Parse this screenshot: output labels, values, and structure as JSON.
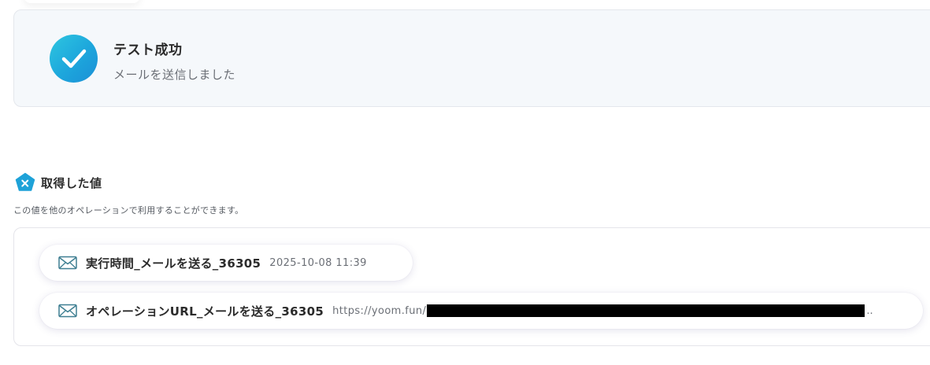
{
  "success": {
    "title": "テスト成功",
    "message": "メールを送信しました",
    "icon": "check-icon",
    "accent": "#1da6dc"
  },
  "values_section": {
    "icon": "pentagon-x-icon",
    "title": "取得した値",
    "description": "この値を他のオペレーションで利用することができます。",
    "items": [
      {
        "icon": "mail-icon",
        "label": "実行時間_メールを送る_36305",
        "value": "2025-10-08 11:39"
      },
      {
        "icon": "mail-icon",
        "label": "オペレーションURL_メールを送る_36305",
        "value": "https://yoom.fun/",
        "value_suffix": ".."
      }
    ]
  }
}
